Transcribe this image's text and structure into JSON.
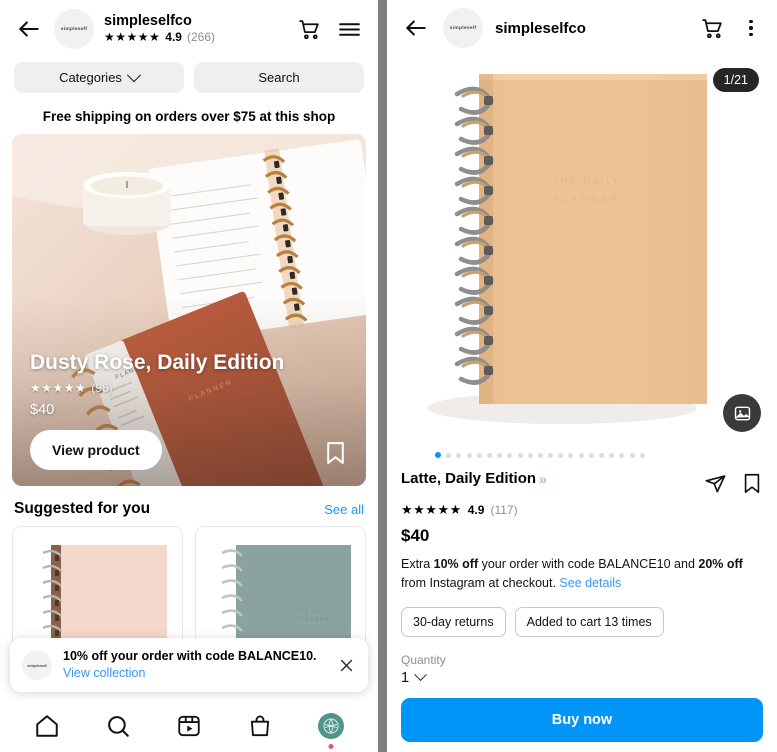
{
  "left": {
    "header": {
      "back_icon": "back-arrow-icon",
      "avatar_text": "simpleself",
      "shop_name": "simpleselfco",
      "stars": "★★★★★",
      "rating": "4.9",
      "rating_count": "(266)",
      "cart_icon": "shopping-cart-icon",
      "menu_icon": "hamburger-menu-icon"
    },
    "pills": {
      "categories": "Categories",
      "search": "Search"
    },
    "free_shipping": "Free shipping on orders over $75 at this shop",
    "hero": {
      "title": "Dusty Rose, Daily Edition",
      "stars": "★★★★★",
      "rating_count": "(96)",
      "price": "$40",
      "view_product": "View product",
      "bookmark_icon": "bookmark-icon"
    },
    "suggested": {
      "title": "Suggested for you",
      "see_all": "See all",
      "items": [
        {
          "name": "blush-spiral-notebook"
        },
        {
          "name": "sage-spiral-notebook"
        }
      ]
    },
    "toast": {
      "avatar_text": "simpleself",
      "message": "10% off your order with code BALANCE10. ",
      "link": "View collection",
      "close_icon": "close-icon"
    },
    "bottom_nav": [
      {
        "name": "home-icon",
        "label": "Home"
      },
      {
        "name": "search-icon",
        "label": "Search"
      },
      {
        "name": "reels-icon",
        "label": "Reels"
      },
      {
        "name": "shop-bag-icon",
        "label": "Shop"
      },
      {
        "name": "profile-avatar",
        "label": "Profile"
      }
    ]
  },
  "right": {
    "header": {
      "back_icon": "back-arrow-icon",
      "avatar_text": "simpleself",
      "shop_name": "simpleselfco",
      "cart_icon": "shopping-cart-icon",
      "more_icon": "kebab-menu-icon"
    },
    "gallery": {
      "counter": "1/21",
      "photo_icon": "photo-gallery-icon",
      "total_dots": 21,
      "active_dot": 1,
      "product_image": "latte-spiral-notebook"
    },
    "product": {
      "title": "Latte, Daily Edition",
      "title_chevron": "»",
      "share_icon": "share-paper-plane-icon",
      "bookmark_icon": "bookmark-icon",
      "stars": "★★★★★",
      "rating": "4.9",
      "rating_count": "(117)",
      "price": "$40",
      "promo_prefix": "Extra ",
      "promo_bold1": "10% off",
      "promo_mid": " your order with code BALANCE10 and ",
      "promo_bold2": "20% off",
      "promo_suffix": " from Instagram at checkout. ",
      "promo_link": "See details",
      "chips": [
        "30-day returns",
        "Added to cart 13 times"
      ],
      "quantity_label": "Quantity",
      "quantity_value": "1",
      "buy_now": "Buy now"
    }
  },
  "colors": {
    "accent_blue": "#0095f6",
    "link_blue": "#3897f0",
    "muted": "#8e8e8e",
    "dark_badge": "#262626"
  }
}
